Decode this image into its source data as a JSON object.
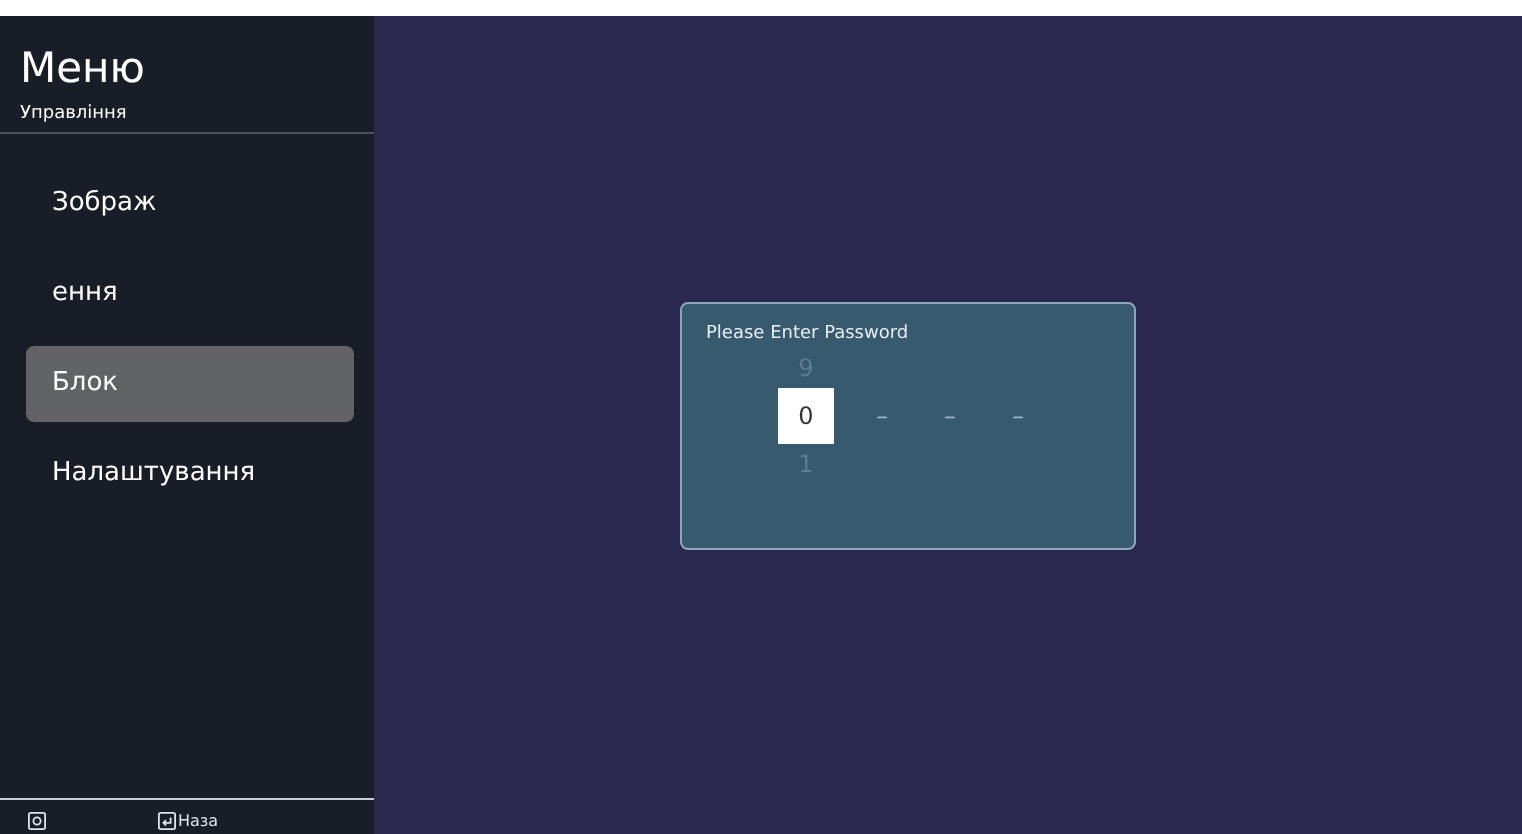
{
  "menu": {
    "title": "Меню",
    "subtitle": "Управління",
    "items": [
      {
        "label": "Зображ",
        "selected": false
      },
      {
        "label": "ення",
        "selected": false
      },
      {
        "label": "Блок",
        "selected": true
      },
      {
        "label": "Налаштування",
        "selected": false
      }
    ]
  },
  "footer": {
    "hints": [
      {
        "kind": "settings"
      },
      {
        "kind": "back",
        "label": "Наза"
      }
    ]
  },
  "dialog": {
    "title": "Please Enter Password",
    "digits": [
      {
        "kind": "wheel",
        "above": "9",
        "value": "0",
        "below": "1"
      },
      {
        "kind": "blank",
        "value": "–"
      },
      {
        "kind": "blank",
        "value": "–"
      },
      {
        "kind": "blank",
        "value": "–"
      }
    ]
  }
}
